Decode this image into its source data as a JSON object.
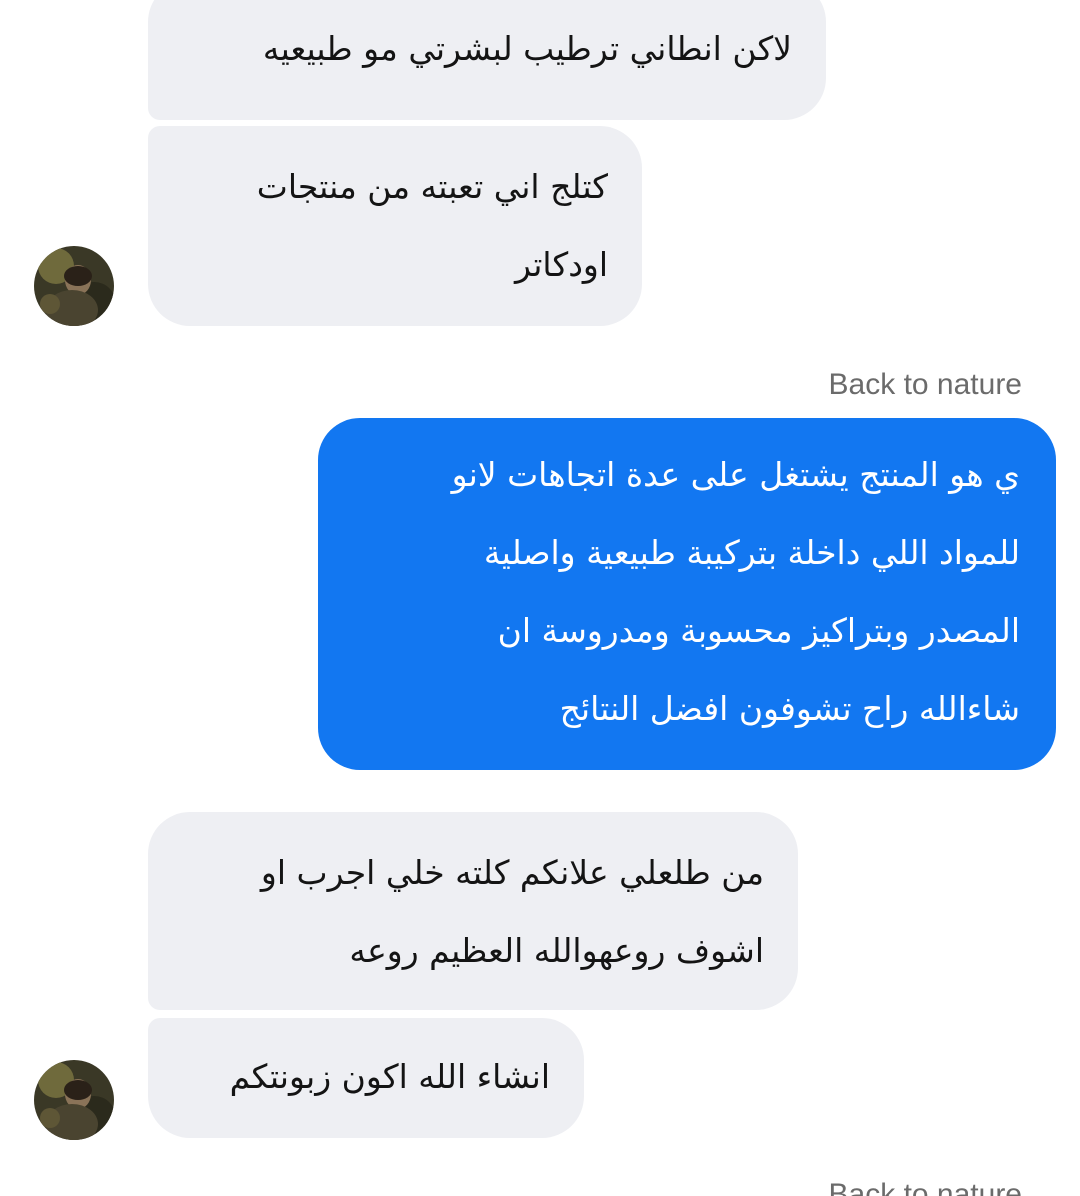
{
  "conversation": {
    "messages": [
      {
        "text": "لاكن انطاني ترطيب لبشرتي مو طبيعيه"
      },
      {
        "line1": "كتلج اني تعبته من منتجات",
        "line2": "اودكاتر"
      },
      {
        "line1": "ي هو المنتج يشتغل على عدة اتجاهات لانو",
        "line2": "للمواد اللي داخلة بتركيبة طبيعية واصلية",
        "line3": "المصدر وبتراكيز محسوبة ومدروسة ان",
        "line4": "شاءالله  راح تشوفون افضل النتائج"
      },
      {
        "line1": "من طلعلي علانكم كلته خلي اجرب او",
        "line2": "اشوف روعهوالله العظيم روعه"
      },
      {
        "text": "انشاء الله اكون زبونتكم"
      }
    ],
    "page_sender_name": "Back to nature",
    "page_sender_name_bottom": "Back to nature"
  },
  "icons": {
    "contact_avatar": "contact-avatar-icon"
  },
  "colors": {
    "incoming_bubble": "#eeeff3",
    "outgoing_bubble": "#1277f1",
    "background": "#ffffff",
    "sender_name": "#6b6b6b"
  }
}
